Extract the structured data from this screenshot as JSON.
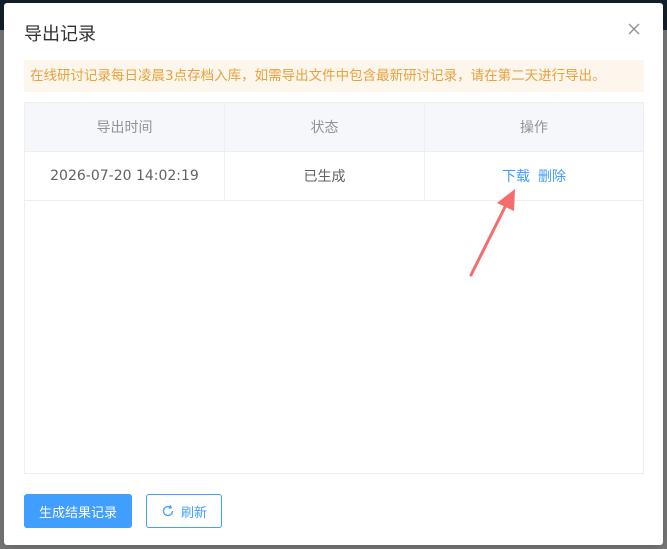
{
  "dialog": {
    "title": "导出记录",
    "notice": "在线研讨记录每日凌晨3点存档入库，如需导出文件中包含最新研讨记录，请在第二天进行导出。"
  },
  "table": {
    "headers": [
      "导出时间",
      "状态",
      "操作"
    ],
    "rows": [
      {
        "time": "2026-07-20 14:02:19",
        "status": "已生成",
        "actions": [
          "下载",
          "删除"
        ]
      }
    ]
  },
  "footer": {
    "generate_label": "生成结果记录",
    "refresh_label": "刷新"
  },
  "icons": {
    "close": "close-icon",
    "refresh": "refresh-icon"
  },
  "colors": {
    "accent": "#409eff",
    "notice_text": "#e6a23c",
    "notice_bg": "#fdf6ec",
    "annotation_arrow": "#f56c6c"
  }
}
